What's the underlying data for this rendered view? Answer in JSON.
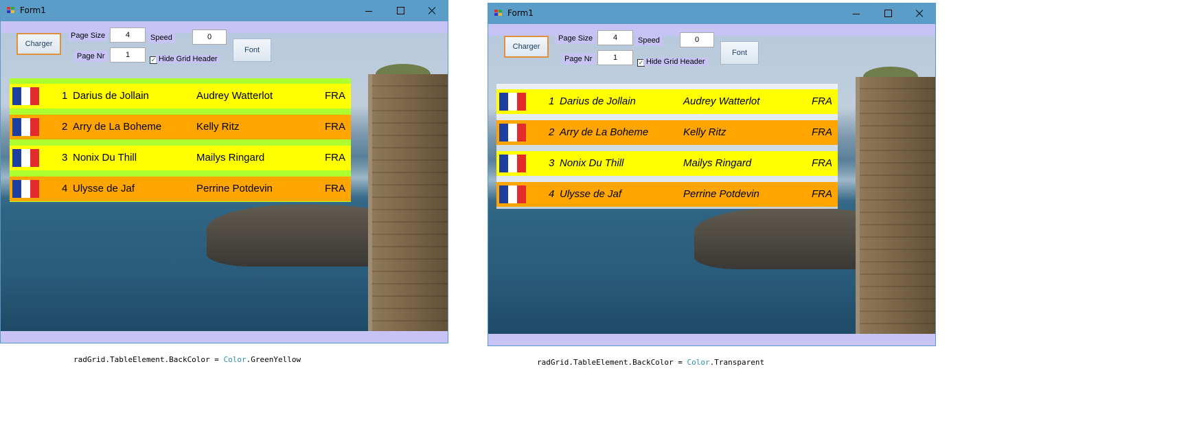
{
  "colors": {
    "titlebar": "#5b9dc9",
    "client": "#c7c3f5",
    "row_yellow": "#ffff00",
    "row_orange": "#ffa500",
    "green_yellow": "#adff2f",
    "flag_blue": "#1f3fa0",
    "flag_white": "#ffffff",
    "flag_red": "#e22b2b"
  },
  "windows": [
    {
      "title": "Form1",
      "controls": {
        "charger_label": "Charger",
        "page_size_label": "Page Size",
        "page_size_value": "4",
        "page_nr_label": "Page Nr",
        "page_nr_value": "1",
        "speed_label": "Speed",
        "speed_value": "0",
        "hide_header_label": "Hide Grid Header",
        "hide_header_checked": true,
        "font_label": "Font"
      },
      "grid": {
        "rows": [
          {
            "flag": "flag-icon",
            "num": "1",
            "horse": "Darius de Jollain",
            "rider": "Audrey Watterlot",
            "nation": "FRA"
          },
          {
            "flag": "flag-icon",
            "num": "2",
            "horse": "Arry de La Boheme",
            "rider": "Kelly Ritz",
            "nation": "FRA"
          },
          {
            "flag": "flag-icon",
            "num": "3",
            "horse": "Nonix Du Thill",
            "rider": "Mailys Ringard",
            "nation": "FRA"
          },
          {
            "flag": "flag-icon",
            "num": "4",
            "horse": "Ulysse de Jaf",
            "rider": "Perrine Potdevin",
            "nation": "FRA"
          }
        ]
      },
      "code": {
        "prefix": "radGrid.TableElement.BackColor = ",
        "type": "Color",
        "value": ".GreenYellow"
      }
    },
    {
      "title": "Form1",
      "controls": {
        "charger_label": "Charger",
        "page_size_label": "Page Size",
        "page_size_value": "4",
        "page_nr_label": "Page Nr",
        "page_nr_value": "1",
        "speed_label": "Speed",
        "speed_value": "0",
        "hide_header_label": "Hide Grid Header",
        "hide_header_checked": true,
        "font_label": "Font"
      },
      "grid": {
        "rows": [
          {
            "flag": "flag-icon",
            "num": "1",
            "horse": "Darius de Jollain",
            "rider": "Audrey Watterlot",
            "nation": "FRA"
          },
          {
            "flag": "flag-icon",
            "num": "2",
            "horse": "Arry de La Boheme",
            "rider": "Kelly Ritz",
            "nation": "FRA"
          },
          {
            "flag": "flag-icon",
            "num": "3",
            "horse": "Nonix Du Thill",
            "rider": "Mailys Ringard",
            "nation": "FRA"
          },
          {
            "flag": "flag-icon",
            "num": "4",
            "horse": "Ulysse de Jaf",
            "rider": "Perrine Potdevin",
            "nation": "FRA"
          }
        ]
      },
      "code": {
        "prefix": "radGrid.TableElement.BackColor = ",
        "type": "Color",
        "value": ".Transparent"
      }
    }
  ]
}
